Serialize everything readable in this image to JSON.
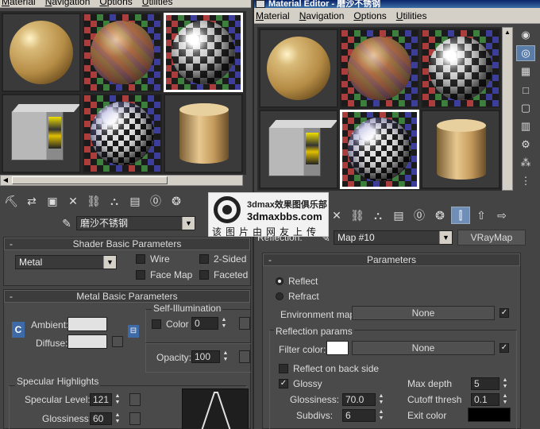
{
  "left_window": {
    "menu": [
      "Material",
      "Navigation",
      "Options",
      "Utilities"
    ],
    "material_name": "磨沙不锈钢",
    "shader_rollout": {
      "title": "Shader Basic Parameters",
      "shader_type": "Metal",
      "checkboxes": [
        "Wire",
        "2-Sided",
        "Face Map",
        "Faceted"
      ]
    },
    "metal_rollout": {
      "title": "Metal Basic Parameters",
      "ambient_label": "Ambient:",
      "diffuse_label": "Diffuse:",
      "lock_label": "C",
      "self_illum_title": "Self-Illumination",
      "color_label": "Color",
      "color_value": "0",
      "opacity_label": "Opacity:",
      "opacity_value": "100"
    },
    "specular": {
      "title": "Specular Highlights",
      "level_label": "Specular Level:",
      "level_value": "121",
      "gloss_label": "Glossiness:",
      "gloss_value": "60"
    }
  },
  "right_window": {
    "title": "Material Editor - 磨沙不锈钢",
    "menu": [
      "Material",
      "Navigation",
      "Options",
      "Utilities"
    ],
    "reflection_label": "Reflection:",
    "map_name": "Map #10",
    "map_type": "VRayMap",
    "params_title": "Parameters",
    "reflect_label": "Reflect",
    "refract_label": "Refract",
    "env_map_label": "Environment map:",
    "env_map_value": "None",
    "refl_params_title": "Reflection params",
    "filter_color_label": "Filter color:",
    "filter_value": "None",
    "back_side_label": "Reflect on back side",
    "glossy_label": "Glossy",
    "glossiness_label": "Glossiness:",
    "glossiness_value": "70.0",
    "subdivs_label": "Subdivs:",
    "subdivs_value": "6",
    "max_depth_label": "Max depth",
    "max_depth_value": "5",
    "cutoff_label": "Cutoff thresh",
    "cutoff_value": "0.1",
    "exit_color_label": "Exit color"
  },
  "watermark": {
    "line1": "3dmax效果图俱乐部",
    "line2": "3dmaxbbs.com",
    "line3": "该图片由网友上传"
  },
  "colors": {
    "filter": "#ffffff",
    "exit": "#000000",
    "ambient": "#e2e2e2",
    "diffuse": "#e2e2e2",
    "active": "#6f8fb8"
  }
}
